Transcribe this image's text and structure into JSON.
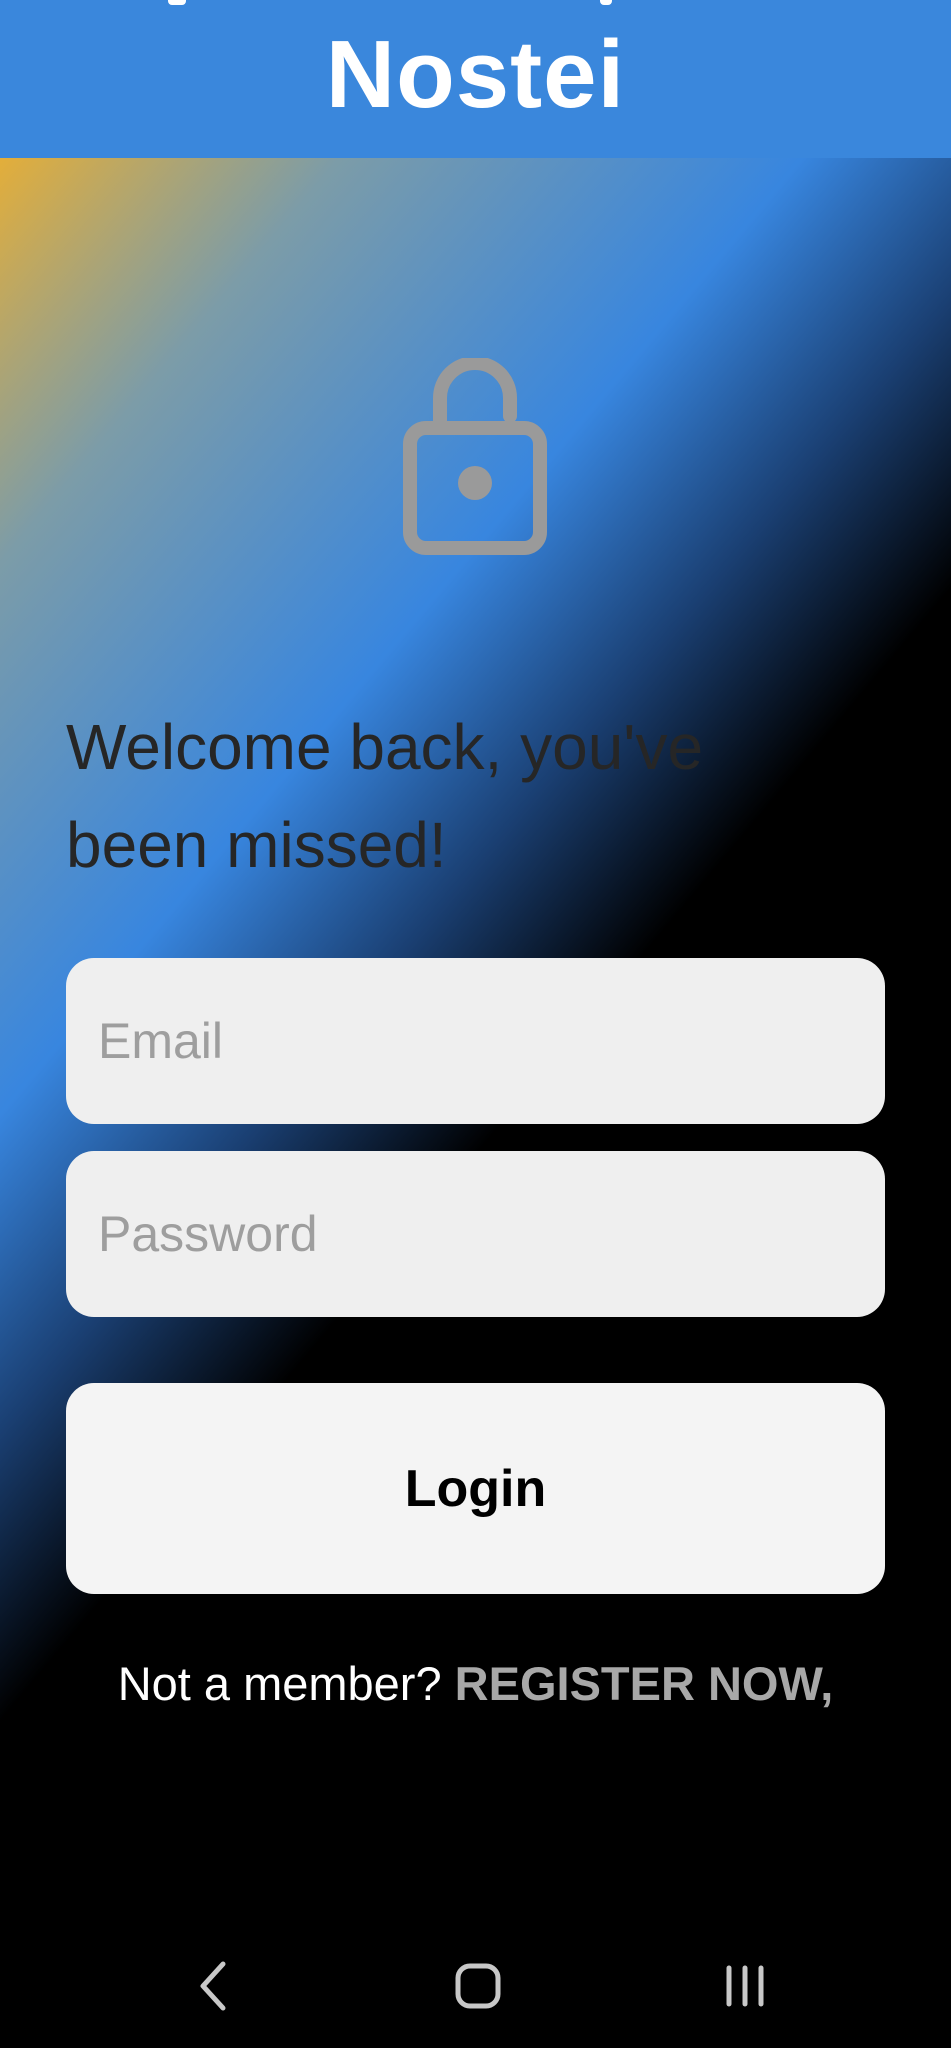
{
  "app_bar": {
    "title": "Nostei"
  },
  "lock": {
    "icon": "unlocked-padlock-icon",
    "color": "#9a9a9a"
  },
  "welcome": {
    "line1": "Welcome back, you've",
    "line2": "been missed!"
  },
  "form": {
    "email_placeholder": "Email",
    "password_placeholder": "Password",
    "login_label": "Login"
  },
  "register": {
    "prompt": "Not a member? ",
    "link_label": "REGISTER NOW,"
  },
  "nav": {
    "back_icon": "back-chevron-icon",
    "home_icon": "home-rounded-square-icon",
    "recents_icon": "recents-bars-icon"
  },
  "colors": {
    "app_bar": "#3a87dc",
    "field_bg": "#efefef",
    "button_bg": "#f4f4f4",
    "link": "#a8a8a8"
  }
}
